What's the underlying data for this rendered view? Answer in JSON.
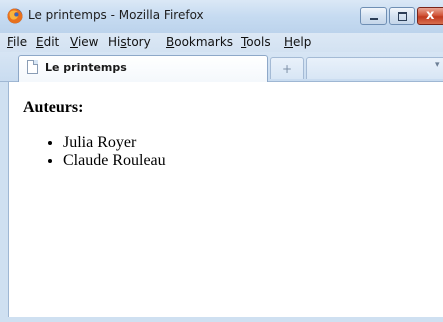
{
  "window": {
    "title": "Le printemps - Mozilla Firefox",
    "app_icon": "firefox-icon",
    "controls": {
      "minimize_icon": "minimize-icon",
      "maximize_icon": "maximize-icon",
      "close_icon": "close-icon",
      "close_glyph": "x"
    }
  },
  "menubar": {
    "items": [
      {
        "accel": "F",
        "rest": "ile"
      },
      {
        "accel": "E",
        "rest": "dit"
      },
      {
        "accel": "V",
        "rest": "iew"
      },
      {
        "pre": "Hi",
        "accel": "s",
        "rest": "tory"
      },
      {
        "accel": "B",
        "rest": "ookmarks"
      },
      {
        "accel": "T",
        "rest": "ools"
      },
      {
        "accel": "H",
        "rest": "elp"
      }
    ]
  },
  "tabs": {
    "active_label": "Le printemps",
    "new_tab_glyph": "+",
    "list_glyph": "▾"
  },
  "page": {
    "heading": "Auteurs:",
    "authors": [
      "Julia Royer",
      "Claude Rouleau"
    ]
  },
  "colors": {
    "frame": "#cfe0f1",
    "close_button": "#c03a1f",
    "content_bg": "#ffffff"
  }
}
